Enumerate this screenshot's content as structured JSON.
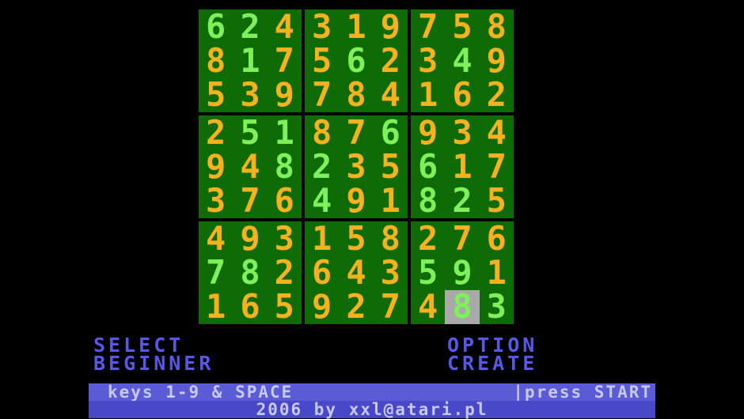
{
  "board": [
    [
      "6",
      "2",
      "4",
      "3",
      "1",
      "9",
      "7",
      "5",
      "8"
    ],
    [
      "8",
      "1",
      "7",
      "5",
      "6",
      "2",
      "3",
      "4",
      "9"
    ],
    [
      "5",
      "3",
      "9",
      "7",
      "8",
      "4",
      "1",
      "6",
      "2"
    ],
    [
      "2",
      "5",
      "1",
      "8",
      "7",
      "6",
      "9",
      "3",
      "4"
    ],
    [
      "9",
      "4",
      "8",
      "2",
      "3",
      "5",
      "6",
      "1",
      "7"
    ],
    [
      "3",
      "7",
      "6",
      "4",
      "9",
      "1",
      "8",
      "2",
      "5"
    ],
    [
      "4",
      "9",
      "3",
      "1",
      "5",
      "8",
      "2",
      "7",
      "6"
    ],
    [
      "7",
      "8",
      "2",
      "6",
      "4",
      "3",
      "5",
      "9",
      "1"
    ],
    [
      "1",
      "6",
      "5",
      "9",
      "2",
      "7",
      "4",
      "8",
      "3"
    ]
  ],
  "entered_cells": [
    [
      0,
      0
    ],
    [
      0,
      1
    ],
    [
      1,
      1
    ],
    [
      1,
      4
    ],
    [
      1,
      7
    ],
    [
      3,
      1
    ],
    [
      3,
      2
    ],
    [
      3,
      5
    ],
    [
      4,
      2
    ],
    [
      4,
      3
    ],
    [
      4,
      6
    ],
    [
      5,
      3
    ],
    [
      5,
      6
    ],
    [
      5,
      7
    ],
    [
      7,
      0
    ],
    [
      7,
      1
    ],
    [
      7,
      6
    ],
    [
      7,
      7
    ],
    [
      8,
      7
    ],
    [
      8,
      8
    ]
  ],
  "cursor": [
    8,
    7
  ],
  "colors": {
    "box_bg": "#0e6b06",
    "given_digit": "#f5b21e",
    "entered_digit": "#7df05a",
    "cursor_bg": "#a9a9a9",
    "menu_text": "#5757e8",
    "status_bar": "#5b5bd6"
  },
  "menu": {
    "select_label": "SELECT",
    "select_value": "BEGINNER",
    "option_label": "OPTION",
    "option_value": "CREATE"
  },
  "status": {
    "keys_hint": "keys 1-9 & SPACE",
    "start_hint": "|press START",
    "footer": "2006 by xxl@atari.pl"
  }
}
